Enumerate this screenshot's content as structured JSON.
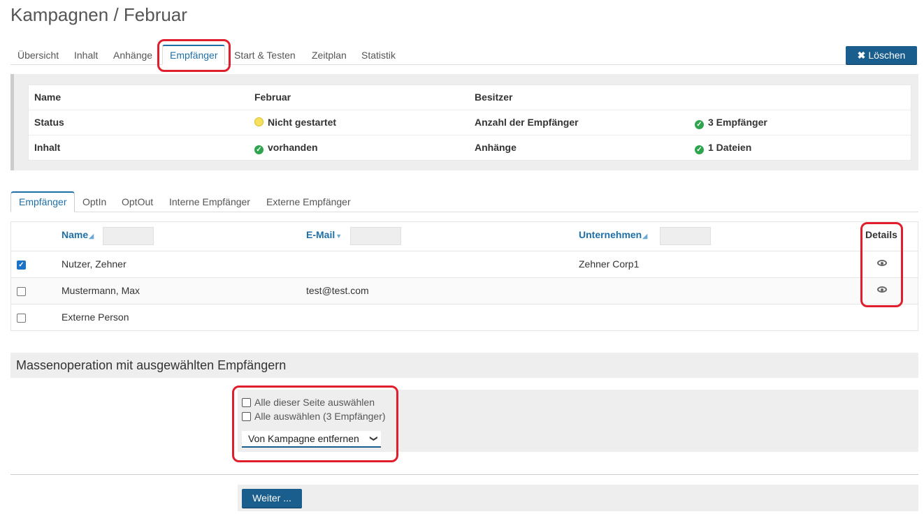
{
  "page": {
    "title": "Kampagnen / Februar"
  },
  "tabs": [
    {
      "label": "Übersicht"
    },
    {
      "label": "Inhalt"
    },
    {
      "label": "Anhänge"
    },
    {
      "label": "Empfänger",
      "active": true
    },
    {
      "label": "Start & Testen"
    },
    {
      "label": "Zeitplan"
    },
    {
      "label": "Statistik"
    }
  ],
  "actions": {
    "delete_label": "Löschen"
  },
  "info": {
    "name_label": "Name",
    "name_value": "Februar",
    "owner_label": "Besitzer",
    "owner_value": "",
    "status_label": "Status",
    "status_value": "Nicht gestartet",
    "recipients_label": "Anzahl der Empfänger",
    "recipients_value": "3 Empfänger",
    "content_label": "Inhalt",
    "content_value": "vorhanden",
    "attachments_label": "Anhänge",
    "attachments_value": "1 Dateien"
  },
  "subtabs": [
    {
      "label": "Empfänger",
      "active": true
    },
    {
      "label": "OptIn"
    },
    {
      "label": "OptOut"
    },
    {
      "label": "Interne Empfänger"
    },
    {
      "label": "Externe Empfänger"
    }
  ],
  "grid": {
    "columns": {
      "name": "Name",
      "email": "E-Mail",
      "company": "Unternehmen",
      "details": "Details"
    },
    "rows": [
      {
        "checked": true,
        "name": "Nutzer, Zehner",
        "email": "",
        "company": "Zehner Corp1",
        "details": true
      },
      {
        "checked": false,
        "name": "Mustermann, Max",
        "email": "test@test.com",
        "company": "",
        "details": true
      },
      {
        "checked": false,
        "name": "Externe Person",
        "email": "",
        "company": "",
        "details": false
      }
    ]
  },
  "mass": {
    "title": "Massenoperation mit ausgewählten Empfängern",
    "select_page_label": "Alle dieser Seite auswählen",
    "select_all_label": "Alle auswählen (3 Empfänger)",
    "operation_selected": "Von Kampagne entfernen",
    "next_label": "Weiter ..."
  },
  "colors": {
    "primary": "#1a5e8e",
    "link": "#1f6fa7",
    "highlight": "#e01e2e"
  }
}
